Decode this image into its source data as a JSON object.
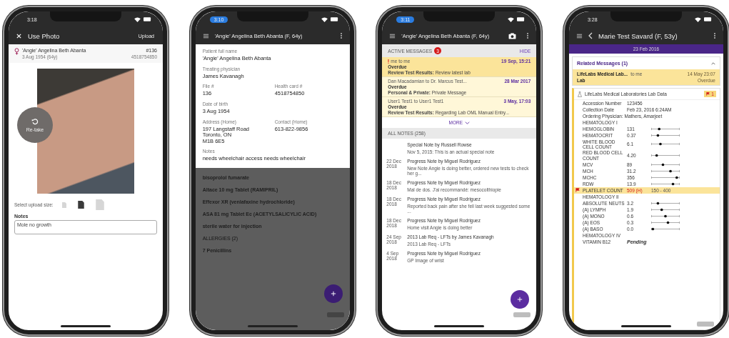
{
  "photo_screen": {
    "status_time": "3:18",
    "time_pill": false,
    "title": "Use Photo",
    "action": "Upload",
    "patient": {
      "name": "'Angie' Angelina Beth Abanta",
      "dob": "3 Aug 1954 (64y)",
      "file": "#136",
      "card": "4518754850"
    },
    "retake": "Re-take",
    "upload_size_label": "Select upload size:",
    "sizes": [
      {
        "selected": false
      },
      {
        "selected": true
      },
      {
        "selected": false
      }
    ],
    "notes_label": "Notes",
    "notes_value": "Mole no growth"
  },
  "profile_screen": {
    "status_time": "3:10",
    "time_pill": true,
    "title": "'Angie' Angelina Beth Abanta (F, 64y)",
    "fields": [
      {
        "label": "Patient full name",
        "value": "'Angie' Angelina Beth Abanta"
      },
      {
        "label": "Treating physician",
        "value": "James Kavanagh"
      },
      {
        "label": "File #",
        "value": "136"
      },
      {
        "label": "Health card #",
        "value": "4518754850"
      },
      {
        "label": "Date of birth",
        "value": "3 Aug 1954"
      },
      {
        "label": "Address (Home)",
        "value": "197 Langstaff Road\nToronto, ON\nM1B 6E5"
      },
      {
        "label": "Contact (Home)",
        "value": "613-822-9856"
      },
      {
        "label": "Notes",
        "value": "needs wheelchair access needs wheelchair"
      }
    ],
    "background_items": [
      {
        "kind": "item",
        "text": "bisoprolol fumarate"
      },
      {
        "kind": "item",
        "text": "Altace 10 mg Tablet (RAMIPRIL)"
      },
      {
        "kind": "item",
        "text": "Effexor XR (venlafaxine hydrochloride)"
      },
      {
        "kind": "item",
        "text": "ASA 81 mg Tablet Ec (ACETYLSALICYLIC ACID)"
      },
      {
        "kind": "item",
        "text": "sterile water for injection"
      },
      {
        "kind": "section",
        "text": "ALLERGIES (2)"
      },
      {
        "kind": "item",
        "text": "7 Penicillins"
      }
    ]
  },
  "chart_screen": {
    "status_time": "3:11",
    "time_pill": true,
    "title": "'Angie' Angelina Beth Abanta (F, 64y)",
    "active_label": "ACTIVE MESSAGES",
    "active_count": "3",
    "hide": "HIDE",
    "messages": [
      {
        "urgent": true,
        "highlight": true,
        "from": "me to me",
        "date": "19 Sep, 15:21",
        "status": "Overdue",
        "body": "**Review Test Results:** Review latest lab"
      },
      {
        "urgent": false,
        "highlight": false,
        "from": "Dan Macadamian to Dr. Marcus Test...",
        "date": "28 Mar 2017",
        "status": "Overdue",
        "body": "**Personal & Private:** Private Message"
      },
      {
        "urgent": false,
        "highlight": false,
        "from": "User1 Test1 to User1 Test1",
        "date": "3 May, 17:03",
        "status": "Overdue",
        "body": "**Review Test Results:** Regarding Lab OML Manual Entry..."
      }
    ],
    "more": "MORE",
    "notes_label": "ALL NOTES (258)",
    "notes": [
      {
        "title": "Special Note by Russell Rowse",
        "text": "Nov 5, 2015: This is an actual special note"
      },
      {
        "date": "22 Dec\n2018",
        "title": "Progress Note by Miguel Rodriguez",
        "text": "New Note Angie is doing better, ordered new tests to check her g..."
      },
      {
        "date": "18 Dec\n2018",
        "title": "Progress Note by Miguel Rodriguez",
        "text": "Mal de dos. J'ai recommandé: mesocolthiopie"
      },
      {
        "date": "18 Dec\n2018",
        "title": "Progress Note by Miguel Rodriguez",
        "text": "Reported back pain after she fell last week suggested some ..."
      },
      {
        "date": "18 Dec\n2018",
        "title": "Progress Note by Miguel Rodriguez",
        "text": "Home visit Angie is doing better"
      },
      {
        "date": "24 Sep\n2018",
        "title": "2013 Lab Req - LFTs by James Kavanagh",
        "text": "2013 Lab Req - LFTs"
      },
      {
        "date": "4 Sep\n2018",
        "title": "Progress Note by Miguel Rodriguez",
        "text": "GP Image of wrist"
      }
    ]
  },
  "lab_screen": {
    "status_time": "3:28",
    "time_pill": false,
    "title": "Marie Test Savard (F, 53y)",
    "date_band": "23 Feb 2016",
    "related_label": "Related Messages (1)",
    "related": {
      "from": "LifeLabs Medical Lab...",
      "to": "to me",
      "date": "14 May 23:07",
      "subject": "Lab",
      "status": "Overdue"
    },
    "lab_title": "LifeLabs Medical Laboratories Lab Data",
    "flag_count": "1",
    "rows": [
      {
        "kind": "meta",
        "name": "Accession Number",
        "value": "123456"
      },
      {
        "kind": "meta",
        "name": "Collection Date",
        "value": "Feb 23, 2016 6:24AM"
      },
      {
        "kind": "header",
        "name": "Ordering Physician: Mathers, Amarjeet"
      },
      {
        "kind": "header",
        "name": "HEMATOLOGY I"
      },
      {
        "kind": "result",
        "name": "HEMOGLOBIN",
        "value": "131",
        "level": 0.25
      },
      {
        "kind": "result",
        "name": "HEMATOCRIT",
        "value": "0.37",
        "level": 0.2
      },
      {
        "kind": "result",
        "name": "WHITE BLOOD CELL COUNT",
        "value": "6.1",
        "level": 0.3
      },
      {
        "kind": "result",
        "name": "RED BLOOD CELL COUNT",
        "value": "4.20",
        "level": 0.15
      },
      {
        "kind": "result",
        "name": "MCV",
        "value": "89",
        "level": 0.4
      },
      {
        "kind": "result",
        "name": "MCH",
        "value": "31.2",
        "level": 0.7
      },
      {
        "kind": "result",
        "name": "MCHC",
        "value": "356",
        "level": 0.95
      },
      {
        "kind": "result",
        "name": "RDW",
        "value": "13.9",
        "level": 0.8
      },
      {
        "kind": "flagged",
        "name": "PLATELET COUNT",
        "value": "509 (H)",
        "range": "150 - 400"
      },
      {
        "kind": "header",
        "name": "HEMATOLOGY II"
      },
      {
        "kind": "result",
        "name": "ABSOLUTE NEUTS",
        "value": "3.2",
        "level": 0.2
      },
      {
        "kind": "result",
        "name": "(A) LYMPH",
        "value": "1.9",
        "level": 0.35
      },
      {
        "kind": "result",
        "name": "(A) MONO",
        "value": "0.6",
        "level": 0.5
      },
      {
        "kind": "result",
        "name": "(A) EOS",
        "value": "0.3",
        "level": 0.6
      },
      {
        "kind": "result",
        "name": "(A) BASO",
        "value": "0.0",
        "level": 0.0
      },
      {
        "kind": "header",
        "name": "HEMATOLOGY IV"
      },
      {
        "kind": "pending",
        "name": "VITAMIN B12",
        "value": "Pending"
      }
    ]
  }
}
